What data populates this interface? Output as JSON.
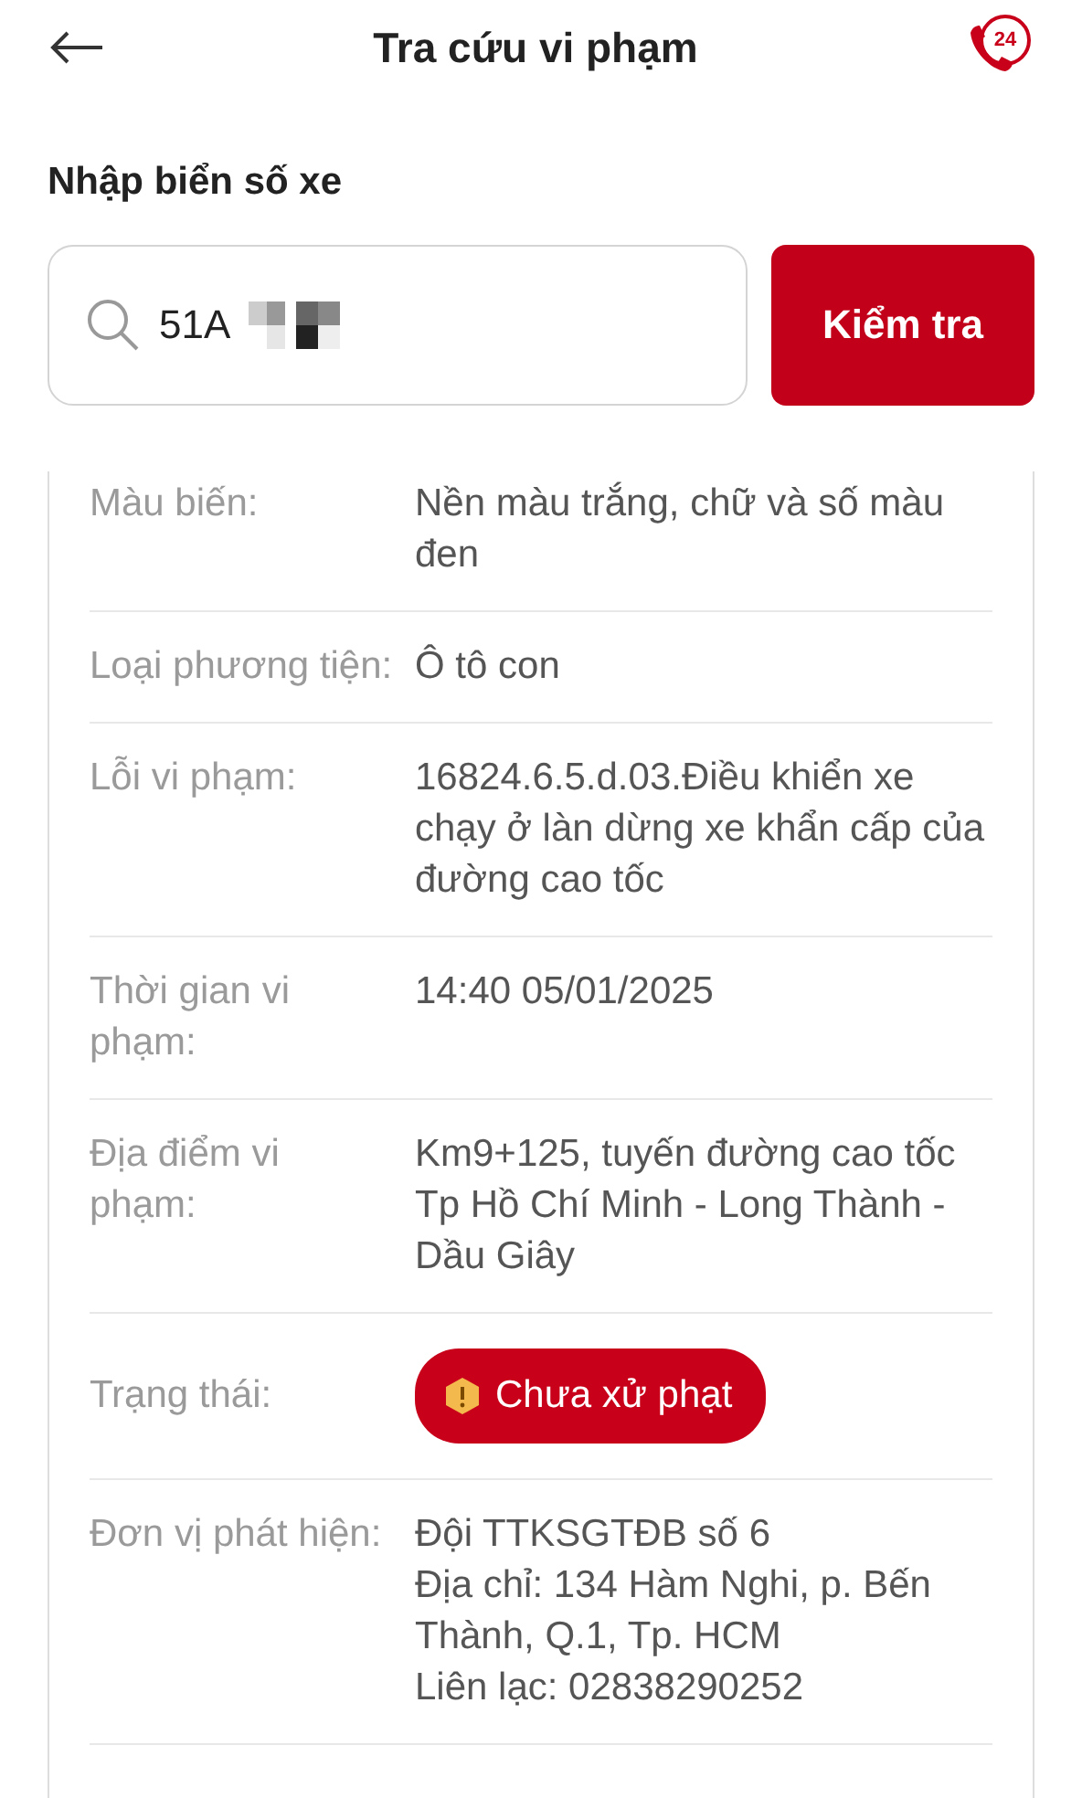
{
  "header": {
    "title": "Tra cứu vi phạm",
    "hotline_badge": "24"
  },
  "search": {
    "label": "Nhập biển số xe",
    "value": "51A",
    "redacted": true,
    "button": "Kiểm tra"
  },
  "details": [
    {
      "label": "Màu biến:",
      "kind": "text",
      "lines": [
        "Nền màu trắng, chữ và số màu đen"
      ]
    },
    {
      "label": "Loại phương tiện:",
      "kind": "text",
      "lines": [
        "Ô tô con"
      ]
    },
    {
      "label": "Lỗi vi phạm:",
      "kind": "text",
      "lines": [
        "16824.6.5.d.03.Điều khiển xe chạy ở làn dừng xe khẩn cấp của đường cao tốc"
      ]
    },
    {
      "label": "Thời gian vi phạm:",
      "kind": "text",
      "lines": [
        "14:40 05/01/2025"
      ]
    },
    {
      "label": "Địa điểm vi phạm:",
      "kind": "text",
      "lines": [
        "Km9+125, tuyến đường cao tốc Tp Hồ Chí Minh - Long Thành - Dầu Giây"
      ]
    },
    {
      "label": "Trạng thái:",
      "kind": "badge",
      "color": "#c8001a",
      "lines": [
        "Chưa xử phạt"
      ]
    },
    {
      "label": "Đơn vị phát hiện:",
      "kind": "text",
      "lines": [
        "Đội TTKSGTĐB số 6",
        "Địa chỉ: 134 Hàm Nghi, p. Bến Thành, Q.1, Tp. HCM",
        "Liên lạc: 02838290252"
      ]
    }
  ]
}
